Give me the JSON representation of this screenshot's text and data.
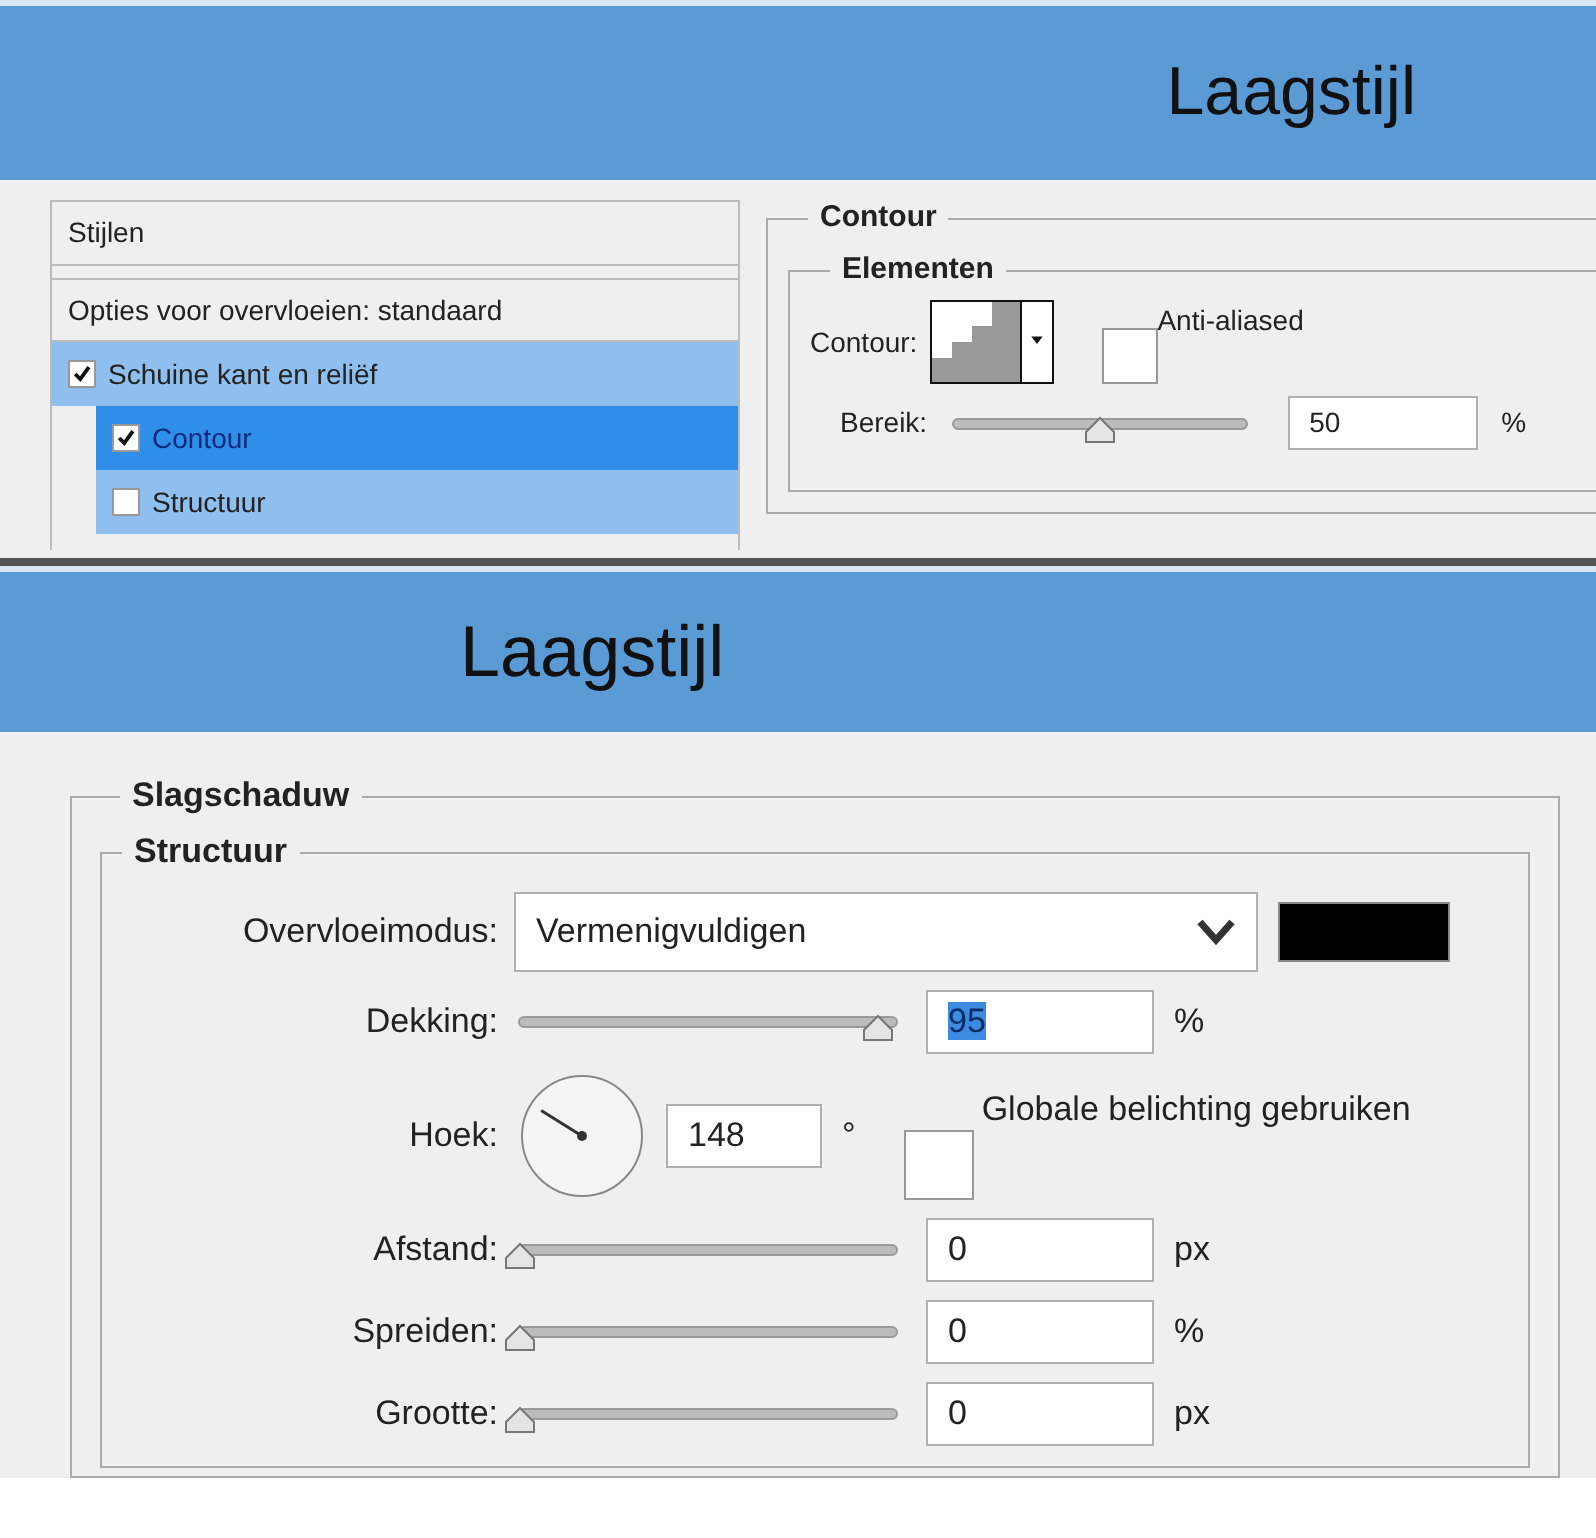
{
  "top_dialog": {
    "title": "Laagstijl",
    "styles": [
      {
        "kind": "header",
        "label": "Stijlen"
      },
      {
        "kind": "header",
        "label": "Opties voor overvloeien: standaard"
      },
      {
        "kind": "check",
        "label": "Schuine kant en reliëf",
        "checked": true,
        "selected": false,
        "children": [
          {
            "kind": "check",
            "label": "Contour",
            "checked": true,
            "selected": true
          },
          {
            "kind": "check",
            "label": "Structuur",
            "checked": false,
            "selected": false
          }
        ]
      }
    ],
    "section": "Contour",
    "group": "Elementen",
    "contour_label": "Contour:",
    "anti_aliased": {
      "label": "Anti-aliased",
      "checked": false
    },
    "range": {
      "label": "Bereik:",
      "level": 0.5,
      "value": "50",
      "unit": "%"
    }
  },
  "bottom_dialog": {
    "title": "Laagstijl",
    "section": "Slagschaduw",
    "group": "Structuur",
    "blend": {
      "label": "Overvloeimodus:",
      "value": "Vermenigvuldigen",
      "color": "#000000"
    },
    "opacity": {
      "label": "Dekking:",
      "level": 0.95,
      "value": "95",
      "unit": "%",
      "value_selected": true
    },
    "angle": {
      "label": "Hoek:",
      "value": "148",
      "unit": "°",
      "global_light": {
        "label": "Globale belichting gebruiken",
        "checked": false
      }
    },
    "sliders": [
      {
        "label": "Afstand:",
        "level": 0,
        "value": "0",
        "unit": "px"
      },
      {
        "label": "Spreiden:",
        "level": 0,
        "value": "0",
        "unit": "%"
      },
      {
        "label": "Grootte:",
        "level": 0,
        "value": "0",
        "unit": "px"
      }
    ]
  }
}
